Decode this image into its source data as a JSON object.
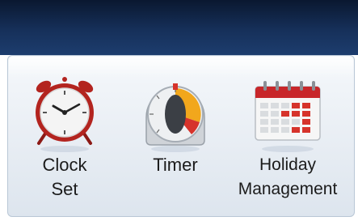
{
  "menu": {
    "items": [
      {
        "line1": "Clock",
        "line2": "Set",
        "icon": "alarm-clock-icon"
      },
      {
        "line1": "Timer",
        "line2": "",
        "icon": "timer-icon"
      },
      {
        "line1": "Holiday",
        "line2": "Management",
        "icon": "calendar-icon"
      }
    ]
  },
  "colors": {
    "header": "#16305a",
    "panel": "#e9eef4",
    "clock_red": "#b3241f",
    "timer_orange": "#f2a71c",
    "calendar_red": "#c8262a"
  }
}
